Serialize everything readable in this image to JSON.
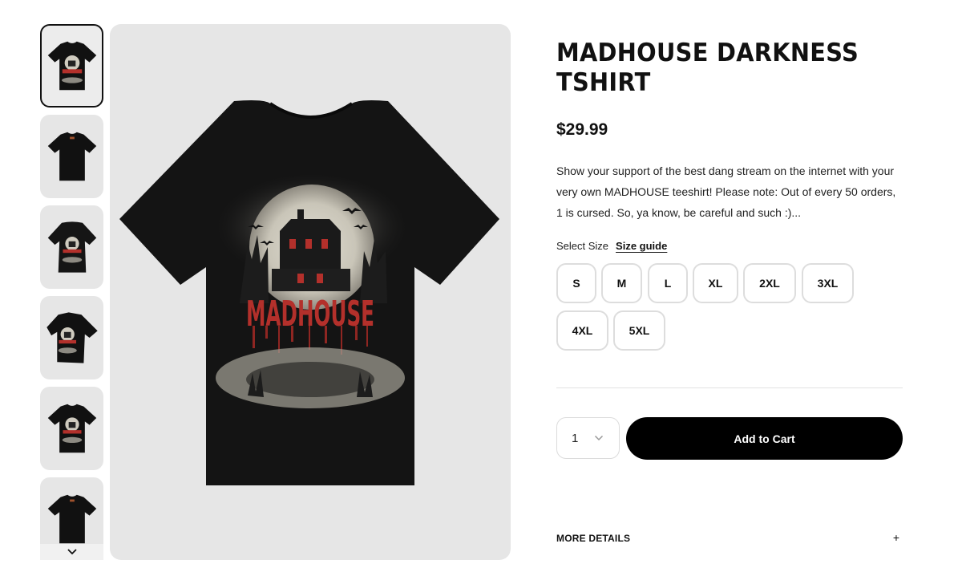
{
  "product": {
    "title": "MADHOUSE DARKNESS TSHIRT",
    "price": "$29.99",
    "description": "Show your support of the best dang stream on the internet with your very own MADHOUSE teeshirt! Please note: Out of every 50 orders, 1 is cursed. So, ya know, be careful and such :)...",
    "graphic_text": "MADHOUSE"
  },
  "size_select": {
    "label": "Select Size",
    "guide_label": "Size guide",
    "options": [
      "S",
      "M",
      "L",
      "XL",
      "2XL",
      "3XL",
      "4XL",
      "5XL"
    ]
  },
  "cart": {
    "quantity": "1",
    "add_label": "Add to Cart"
  },
  "details": {
    "label": "MORE DETAILS",
    "toggle": "+"
  },
  "icons": {
    "thumb_arrow": "chevron-down-icon",
    "qty_arrow": "chevron-down-icon",
    "details_toggle": "plus-icon"
  },
  "colors": {
    "shirt": "#111111",
    "graphic_red": "#b3302b",
    "moon": "#cfcbbf",
    "button": "#000000",
    "panel": "#e6e6e6"
  }
}
